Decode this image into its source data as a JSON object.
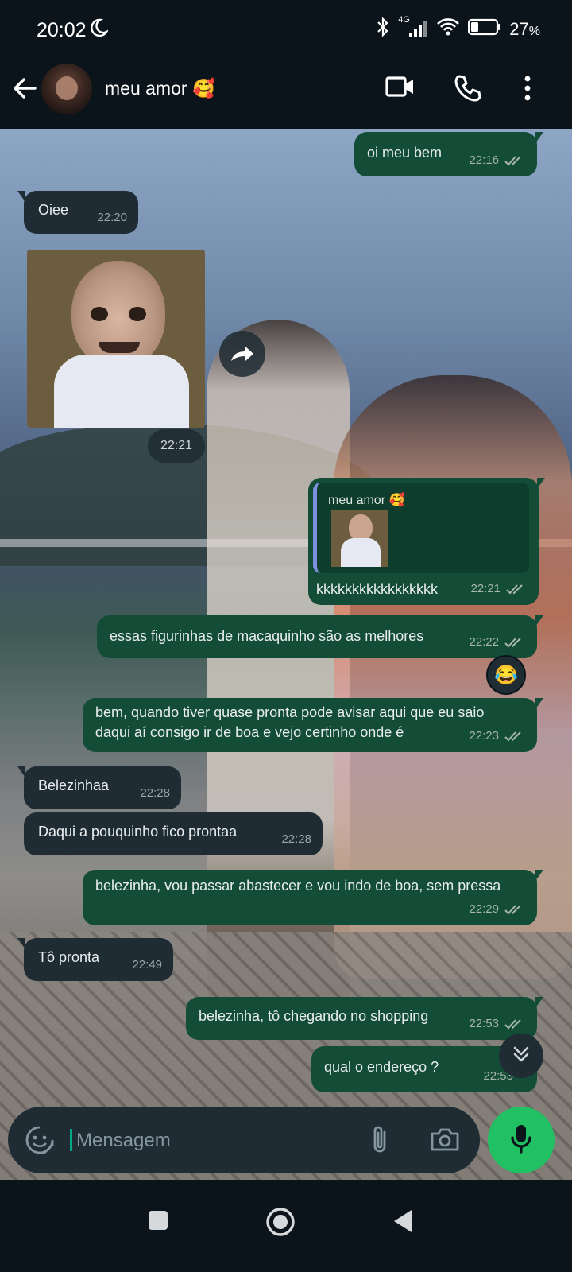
{
  "status_bar": {
    "time": "20:02",
    "network": "4G",
    "battery": "27",
    "battery_unit": "%"
  },
  "header": {
    "contact_name": "meu amor",
    "contact_emoji": "🥰"
  },
  "messages": [
    {
      "text": "oi meu bem",
      "time": "22:16"
    },
    {
      "text": "Oiee",
      "time": "22:20"
    },
    {
      "time": "22:21"
    },
    {
      "reply_to": "meu amor 🥰",
      "text": "kkkkkkkkkkkkkkkkk",
      "time": "22:21"
    },
    {
      "text": "essas figurinhas de macaquinho são as melhores",
      "time": "22:22",
      "reaction": "😂"
    },
    {
      "text": "bem, quando tiver quase pronta pode avisar aqui que eu saio daqui aí consigo ir de boa e vejo certinho onde  é",
      "time": "22:23"
    },
    {
      "text": "Belezinhaa",
      "time": "22:28"
    },
    {
      "text": "Daqui a pouquinho fico prontaa",
      "time": "22:28"
    },
    {
      "text": "belezinha, vou passar abastecer e vou indo de boa, sem pressa",
      "time": "22:29"
    },
    {
      "text": "Tô pronta",
      "time": "22:49"
    },
    {
      "text": "belezinha, tô chegando no shopping",
      "time": "22:53"
    },
    {
      "text": "qual o endereço ?",
      "time": "22:53"
    }
  ],
  "composer": {
    "placeholder": "Mensagem"
  },
  "colors": {
    "outgoing_bubble": "#134d37",
    "incoming_bubble": "#1f2c33",
    "accent": "#21c063",
    "tick_read": "#a7b5ad"
  },
  "icons": [
    "back-arrow-icon",
    "video-call-icon",
    "phone-icon",
    "more-vert-icon",
    "forward-icon",
    "chevron-double-down-icon",
    "sticker-icon",
    "paperclip-icon",
    "camera-icon",
    "mic-icon",
    "nav-recents-icon",
    "nav-home-icon",
    "nav-back-icon"
  ]
}
